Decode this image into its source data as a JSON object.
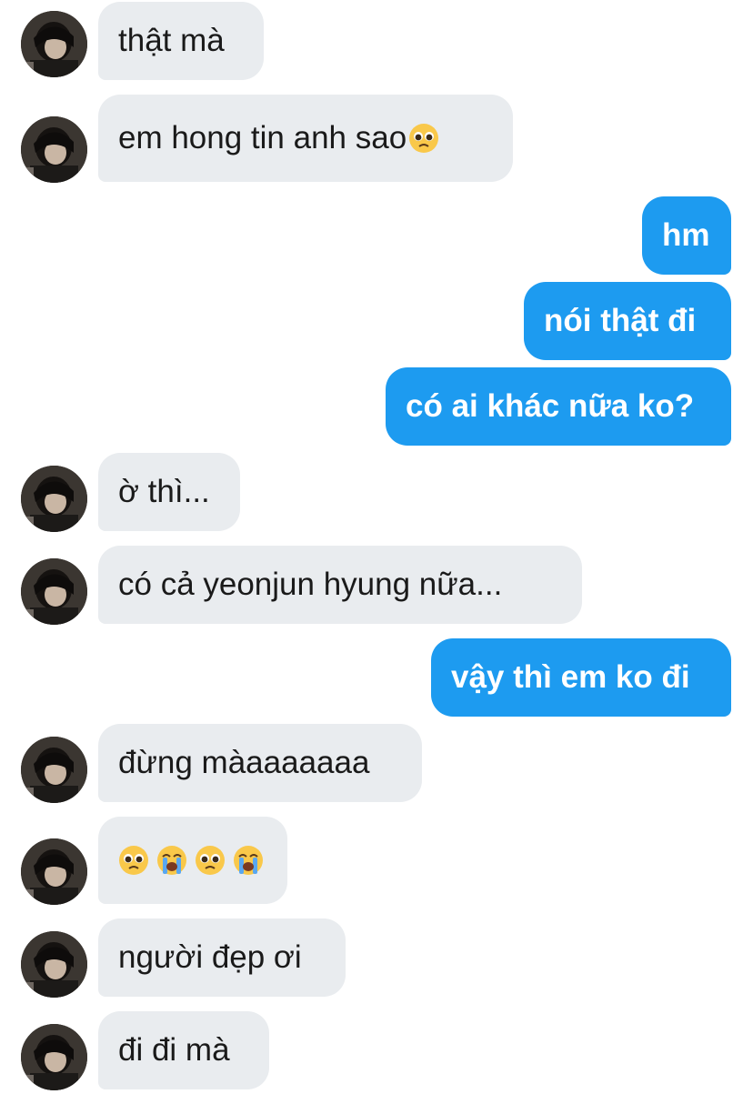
{
  "messages": [
    {
      "side": "in",
      "text": "thật mà"
    },
    {
      "side": "in",
      "text": "em hong tin anh sao",
      "emoji": "pleading-face"
    },
    {
      "side": "out",
      "text": "hm"
    },
    {
      "side": "out",
      "text": "nói thật đi"
    },
    {
      "side": "out",
      "text": "có ai khác nữa ko?"
    },
    {
      "side": "in",
      "text": "ờ thì..."
    },
    {
      "side": "in",
      "text": "có cả yeonjun hyung nữa..."
    },
    {
      "side": "out",
      "text": "vậy thì em ko đi"
    },
    {
      "side": "in",
      "text": "đừng màaaaaaaa"
    },
    {
      "side": "in",
      "emojis": [
        "pleading-face",
        "loudly-crying-face",
        "pleading-face",
        "loudly-crying-face"
      ]
    },
    {
      "side": "in",
      "text": "người đẹp ơi"
    },
    {
      "side": "in",
      "text": "đi đi mà"
    }
  ],
  "colors": {
    "incoming_bubble": "#e9ecef",
    "outgoing_bubble": "#1d9bf0",
    "incoming_text": "#1a1a1a",
    "outgoing_text": "#ffffff"
  }
}
